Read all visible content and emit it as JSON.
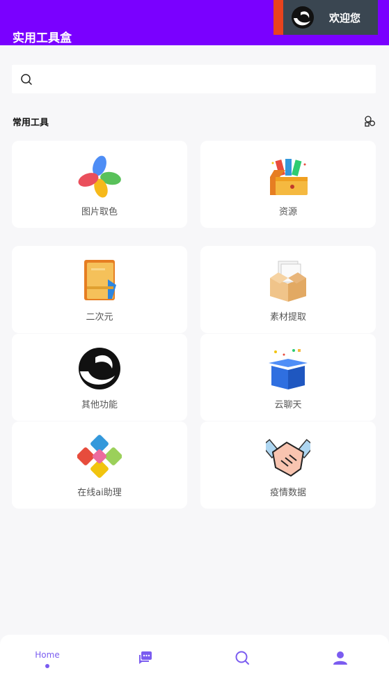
{
  "header": {
    "title": "实用工具盒",
    "welcome_label": "欢迎您"
  },
  "search": {
    "placeholder": ""
  },
  "section": {
    "title": "常用工具"
  },
  "tools": [
    {
      "label": "图片取色"
    },
    {
      "label": "资源"
    },
    {
      "label": "二次元"
    },
    {
      "label": "素材提取"
    },
    {
      "label": "其他功能"
    },
    {
      "label": "云聊天"
    },
    {
      "label": "在线ai助理"
    },
    {
      "label": "疫情数据"
    }
  ],
  "nav": {
    "home_label": "Home"
  },
  "colors": {
    "header_bg": "#7a00ff",
    "accent": "#7a5cf0",
    "nav_icon": "#7b5cf0"
  }
}
